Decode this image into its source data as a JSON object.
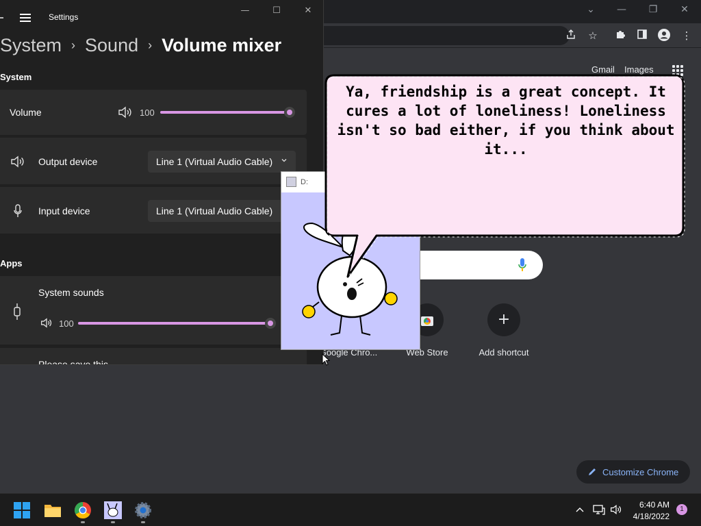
{
  "chrome": {
    "links": {
      "gmail": "Gmail",
      "images": "Images"
    },
    "shortcuts": [
      {
        "label": "Google Chro...",
        "icon": "google-chrome-icon"
      },
      {
        "label": "Web Store",
        "icon": "chrome-web-store-icon"
      },
      {
        "label": "Add shortcut",
        "icon": "plus-icon"
      }
    ],
    "customize_label": "Customize Chrome",
    "accent": "#8ab4f8"
  },
  "settings": {
    "title": "Settings",
    "breadcrumb": {
      "system": "System",
      "sound": "Sound",
      "current": "Volume mixer",
      "separator": "›"
    },
    "system_section": "System",
    "volume": {
      "label": "Volume",
      "value": "100"
    },
    "output": {
      "label": "Output device",
      "value": "Line 1 (Virtual Audio Cable)"
    },
    "input": {
      "label": "Input device",
      "value": "Line 1 (Virtual Audio Cable)"
    },
    "apps_section": "Apps",
    "system_sounds": {
      "label": "System sounds",
      "value": "100"
    },
    "next_item": "Please save this",
    "accent": "#d896e4"
  },
  "pet": {
    "title": "D:"
  },
  "bubble": {
    "text": "Ya, friendship is a great concept. It cures a lot of loneliness! Loneliness isn't so bad either, if you think about it..."
  },
  "taskbar": {
    "apps": [
      "windows-start-icon",
      "file-explorer-icon",
      "chrome-icon",
      "pet-app-icon",
      "settings-gear-icon"
    ],
    "time": "6:40 AM",
    "date": "4/18/2022",
    "notifications": "1"
  }
}
